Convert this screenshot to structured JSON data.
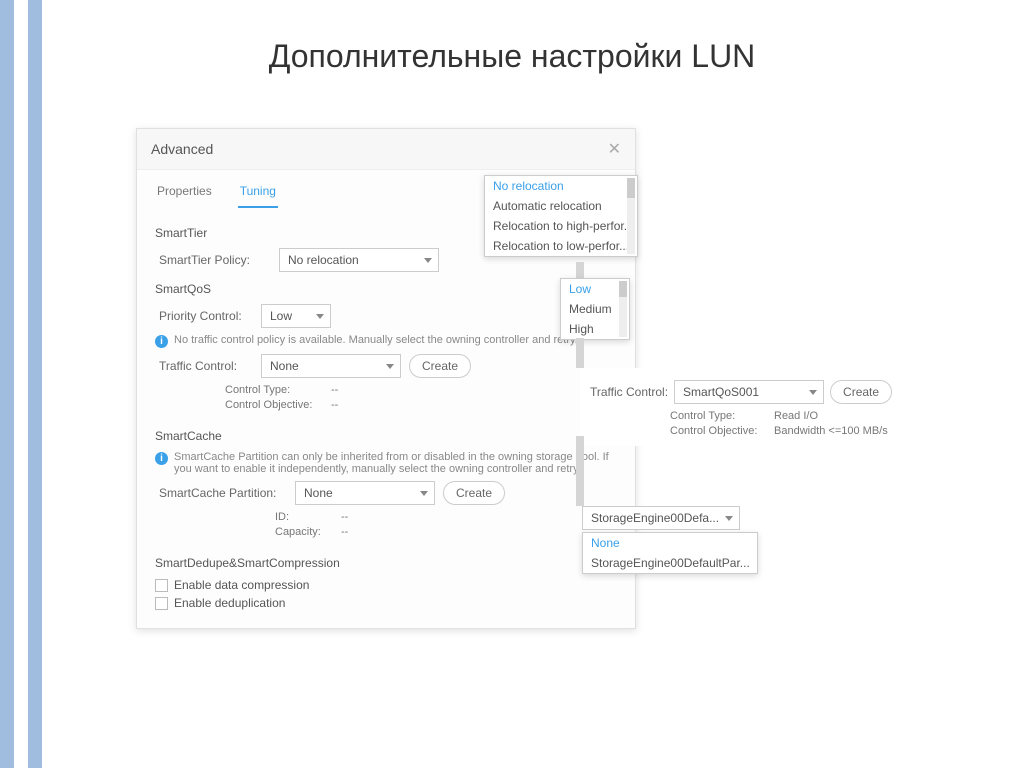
{
  "slide_title": "Дополнительные настройки LUN",
  "dialog": {
    "title": "Advanced",
    "tabs": {
      "properties": "Properties",
      "tuning": "Tuning"
    }
  },
  "smarttier": {
    "section": "SmartTier",
    "policy_label": "SmartTier Policy:",
    "policy_value": "No relocation"
  },
  "relocation_options": {
    "none": "No relocation",
    "auto": "Automatic relocation",
    "high": "Relocation to high-perfor...",
    "low": "Relocation to low-perfor..."
  },
  "smartqos": {
    "section": "SmartQoS",
    "priority_label": "Priority Control:",
    "priority_value": "Low",
    "note": "No traffic control policy is available. Manually select the owning controller and retry.",
    "traffic_label": "Traffic Control:",
    "traffic_value": "None",
    "create": "Create",
    "ctrl_type_k": "Control Type:",
    "ctrl_type_v": "--",
    "ctrl_obj_k": "Control Objective:",
    "ctrl_obj_v": "--"
  },
  "priority_options": {
    "low": "Low",
    "medium": "Medium",
    "high": "High"
  },
  "traffic2": {
    "label": "Traffic Control:",
    "value": "SmartQoS001",
    "create": "Create",
    "ctrl_type_k": "Control Type:",
    "ctrl_type_v": "Read I/O",
    "ctrl_obj_k": "Control Objective:",
    "ctrl_obj_v": "Bandwidth <=100 MB/s"
  },
  "smartcache": {
    "section": "SmartCache",
    "note": "SmartCache Partition can only be inherited from or disabled in the owning storage pool. If you want to enable it independently, manually select the owning controller and retry.",
    "partition_label": "SmartCache Partition:",
    "partition_value": "None",
    "create": "Create",
    "id_k": "ID:",
    "id_v": "--",
    "cap_k": "Capacity:",
    "cap_v": "--"
  },
  "cache_options": {
    "current": "StorageEngine00Defa...",
    "none": "None",
    "default": "StorageEngine00DefaultPar..."
  },
  "dedupe": {
    "section": "SmartDedupe&SmartCompression",
    "compression": "Enable data compression",
    "deduplication": "Enable deduplication"
  }
}
